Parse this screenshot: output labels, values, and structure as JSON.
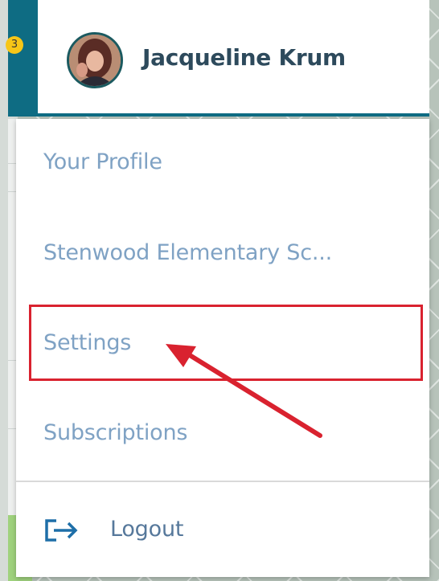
{
  "header": {
    "user_name": "Jacqueline Krum",
    "notification_count": "3"
  },
  "menu": {
    "items": [
      {
        "label": "Your Profile"
      },
      {
        "label": "Stenwood Elementary Sc..."
      },
      {
        "label": "Settings"
      },
      {
        "label": "Subscriptions"
      }
    ],
    "logout_label": "Logout"
  },
  "annotation": {
    "highlighted_item": "Settings",
    "color": "#d9222f"
  },
  "colors": {
    "accent": "#0e6c83",
    "menu_text": "#7fa2c4",
    "name_text": "#2d4a5c",
    "badge": "#f7c617"
  }
}
